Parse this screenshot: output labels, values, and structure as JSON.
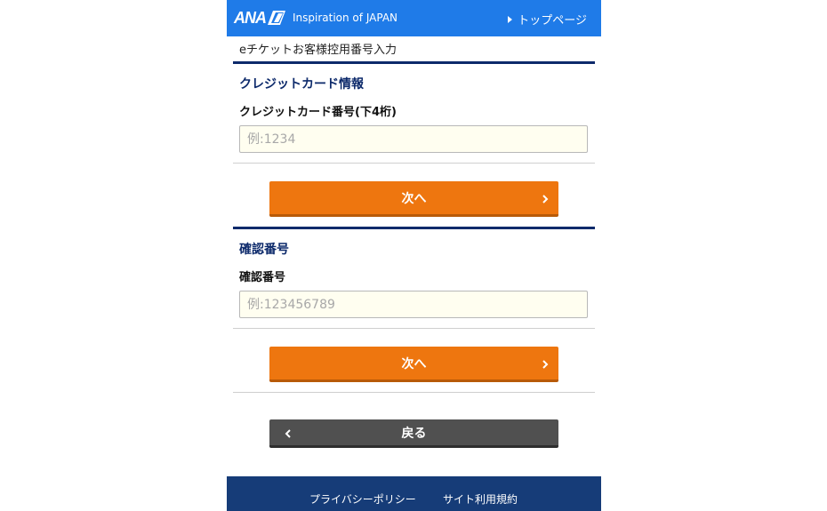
{
  "header": {
    "logo_text": "ANA",
    "tagline": "Inspiration of JAPAN",
    "top_link": "トップページ"
  },
  "breadcrumb": "eチケットお客様控用番号入力",
  "credit_section": {
    "title": "クレジットカード情報",
    "field_label": "クレジットカード番号(下4桁)",
    "placeholder": "例:1234",
    "value": "",
    "next_button": "次へ"
  },
  "confirm_section": {
    "title": "確認番号",
    "field_label": "確認番号",
    "placeholder": "例:123456789",
    "value": "",
    "next_button": "次へ"
  },
  "back_button": "戻る",
  "footer": {
    "privacy": "プライバシーポリシー",
    "terms": "サイト利用規約"
  },
  "colors": {
    "header_blue": "#1f7be8",
    "navy": "#0d2a6b",
    "button_orange": "#ee760f",
    "button_gray": "#505050",
    "footer_blue": "#163c78",
    "input_bg": "#fffef0"
  },
  "icons": {
    "top_link_icon": "triangle-right-icon",
    "next_icon": "chevron-right-icon",
    "back_icon": "chevron-left-icon"
  }
}
